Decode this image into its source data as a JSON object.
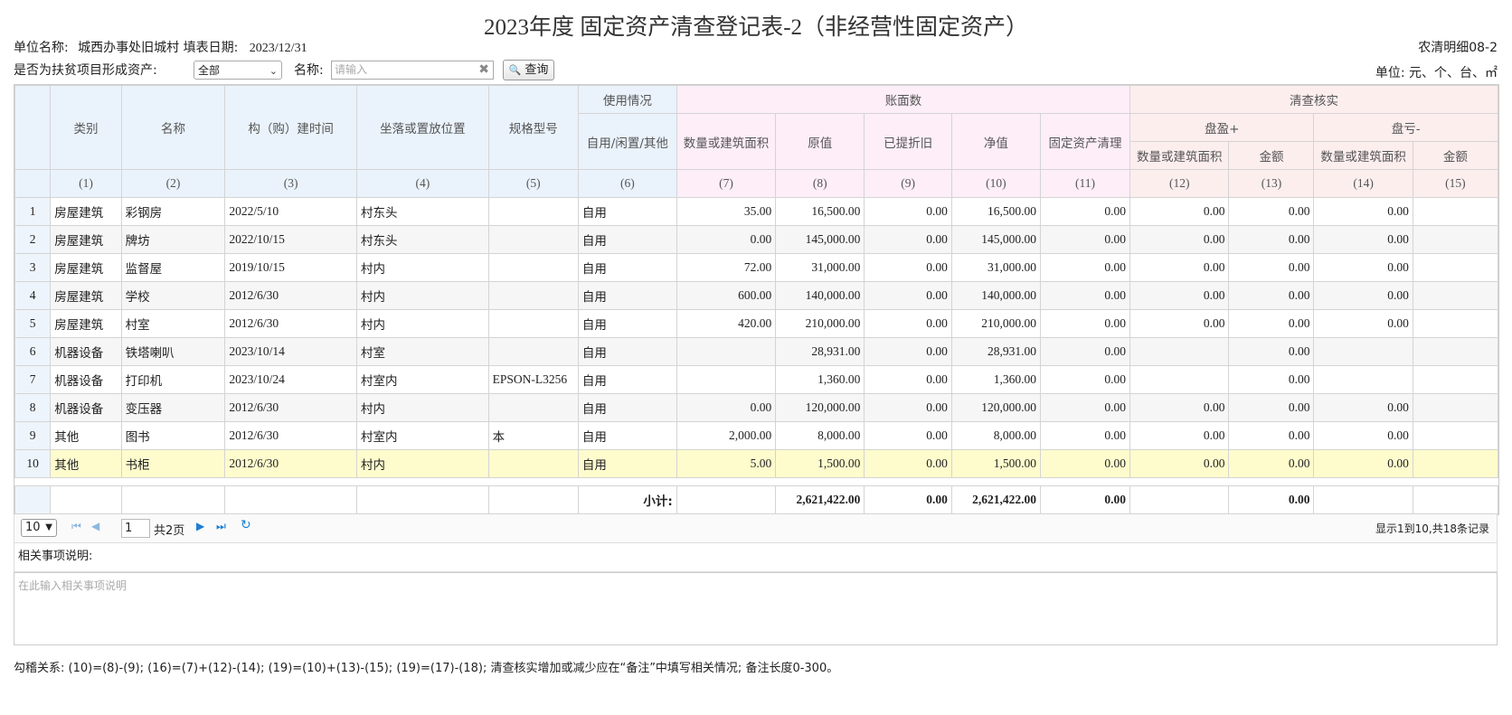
{
  "title": "2023年度 固定资产清查登记表-2（非经营性固定资产）",
  "unit_label": "单位名称:",
  "unit_value": "城西办事处旧城村",
  "date_label": "填表日期:",
  "date_value": "2023/12/31",
  "form_code": "农清明细08-2",
  "units_note": "单位: 元、个、台、㎡",
  "poverty_label": "是否为扶贫项目形成资产:",
  "poverty_select": "全部",
  "name_label": "名称:",
  "name_placeholder": "请输入",
  "query_label": "查询",
  "headers": {
    "category": "类别",
    "name": "名称",
    "build_time": "构（购）建时间",
    "location": "坐落或置放位置",
    "spec": "规格型号",
    "usage_group": "使用情况",
    "usage": "自用/闲置/其他",
    "book_group": "账面数",
    "qty": "数量或建筑面积",
    "orig": "原值",
    "depr": "已提折旧",
    "net": "净值",
    "clear": "固定资产清理",
    "check_group": "清查核实",
    "surplus_group": "盘盈+",
    "loss_group": "盘亏-",
    "qty2": "数量或建筑面积",
    "amount": "金额",
    "qty3": "数量或建筑面积",
    "amount2": "金额"
  },
  "col_numbers": [
    "(1)",
    "(2)",
    "(3)",
    "(4)",
    "(5)",
    "(6)",
    "(7)",
    "(8)",
    "(9)",
    "(10)",
    "(11)",
    "(12)",
    "(13)",
    "(14)",
    "(15)"
  ],
  "rows": [
    {
      "idx": "1",
      "category": "房屋建筑",
      "name": "彩钢房",
      "time": "2022/5/10",
      "location": "村东头",
      "spec": "",
      "usage": "自用",
      "qty": "35.00",
      "orig": "16,500.00",
      "depr": "0.00",
      "net": "16,500.00",
      "clear": "0.00",
      "sq": "0.00",
      "sa": "0.00",
      "lq": "0.00"
    },
    {
      "idx": "2",
      "category": "房屋建筑",
      "name": "牌坊",
      "time": "2022/10/15",
      "location": "村东头",
      "spec": "",
      "usage": "自用",
      "qty": "0.00",
      "orig": "145,000.00",
      "depr": "0.00",
      "net": "145,000.00",
      "clear": "0.00",
      "sq": "0.00",
      "sa": "0.00",
      "lq": "0.00"
    },
    {
      "idx": "3",
      "category": "房屋建筑",
      "name": "监督屋",
      "time": "2019/10/15",
      "location": "村内",
      "spec": "",
      "usage": "自用",
      "qty": "72.00",
      "orig": "31,000.00",
      "depr": "0.00",
      "net": "31,000.00",
      "clear": "0.00",
      "sq": "0.00",
      "sa": "0.00",
      "lq": "0.00"
    },
    {
      "idx": "4",
      "category": "房屋建筑",
      "name": "学校",
      "time": "2012/6/30",
      "location": "村内",
      "spec": "",
      "usage": "自用",
      "qty": "600.00",
      "orig": "140,000.00",
      "depr": "0.00",
      "net": "140,000.00",
      "clear": "0.00",
      "sq": "0.00",
      "sa": "0.00",
      "lq": "0.00"
    },
    {
      "idx": "5",
      "category": "房屋建筑",
      "name": "村室",
      "time": "2012/6/30",
      "location": "村内",
      "spec": "",
      "usage": "自用",
      "qty": "420.00",
      "orig": "210,000.00",
      "depr": "0.00",
      "net": "210,000.00",
      "clear": "0.00",
      "sq": "0.00",
      "sa": "0.00",
      "lq": "0.00"
    },
    {
      "idx": "6",
      "category": "机器设备",
      "name": "铁塔喇叭",
      "time": "2023/10/14",
      "location": "村室",
      "spec": "",
      "usage": "自用",
      "qty": "",
      "orig": "28,931.00",
      "depr": "0.00",
      "net": "28,931.00",
      "clear": "0.00",
      "sq": "",
      "sa": "0.00",
      "lq": ""
    },
    {
      "idx": "7",
      "category": "机器设备",
      "name": "打印机",
      "time": "2023/10/24",
      "location": "村室内",
      "spec": "EPSON-L3256",
      "usage": "自用",
      "qty": "",
      "orig": "1,360.00",
      "depr": "0.00",
      "net": "1,360.00",
      "clear": "0.00",
      "sq": "",
      "sa": "0.00",
      "lq": ""
    },
    {
      "idx": "8",
      "category": "机器设备",
      "name": "变压器",
      "time": "2012/6/30",
      "location": "村内",
      "spec": "",
      "usage": "自用",
      "qty": "0.00",
      "orig": "120,000.00",
      "depr": "0.00",
      "net": "120,000.00",
      "clear": "0.00",
      "sq": "0.00",
      "sa": "0.00",
      "lq": "0.00"
    },
    {
      "idx": "9",
      "category": "其他",
      "name": "图书",
      "time": "2012/6/30",
      "location": "村室内",
      "spec": "本",
      "usage": "自用",
      "qty": "2,000.00",
      "orig": "8,000.00",
      "depr": "0.00",
      "net": "8,000.00",
      "clear": "0.00",
      "sq": "0.00",
      "sa": "0.00",
      "lq": "0.00"
    },
    {
      "idx": "10",
      "category": "其他",
      "name": "书柜",
      "time": "2012/6/30",
      "location": "村内",
      "spec": "",
      "usage": "自用",
      "qty": "5.00",
      "orig": "1,500.00",
      "depr": "0.00",
      "net": "1,500.00",
      "clear": "0.00",
      "sq": "0.00",
      "sa": "0.00",
      "lq": "0.00"
    }
  ],
  "subtotal": {
    "label": "小计:",
    "orig": "2,621,422.00",
    "depr": "0.00",
    "net": "2,621,422.00",
    "clear": "0.00",
    "sa": "0.00"
  },
  "pager": {
    "page_size": "10",
    "page": "1",
    "total_pages": "共2页",
    "info": "显示1到10,共18条记录"
  },
  "notes_label": "相关事项说明:",
  "notes_placeholder": "在此输入相关事项说明",
  "footer": "勾稽关系: (10)=(8)-(9); (16)=(7)+(12)-(14); (19)=(10)+(13)-(15); (19)=(17)-(18); 清查核实增加或减少应在“备注”中填写相关情况; 备注长度0-300。"
}
